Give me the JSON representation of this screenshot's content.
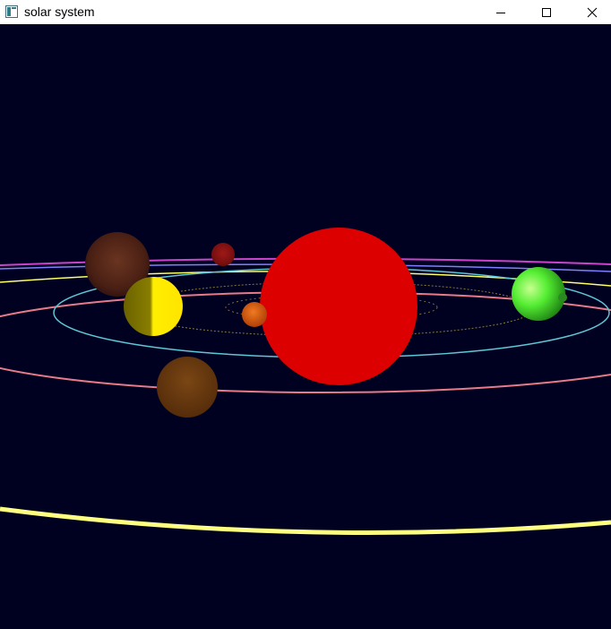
{
  "window": {
    "title": "solar system",
    "icon": "app-window-icon",
    "controls": {
      "minimize_icon": "minimize-icon",
      "maximize_icon": "maximize-icon",
      "close_icon": "close-icon"
    }
  },
  "scene": {
    "background": "#000020",
    "sun_color": "#dd0000",
    "orbit_colors": [
      "#8a7a3a",
      "#5fc6d6",
      "#e87a8a",
      "#ffff66",
      "#8080ff",
      "#cc44cc",
      "#ffff80"
    ],
    "planet_colors": [
      "#d95a10",
      "#ffee00",
      "#6a3a10",
      "#55ee33",
      "#5a2818",
      "#8a1010"
    ]
  }
}
